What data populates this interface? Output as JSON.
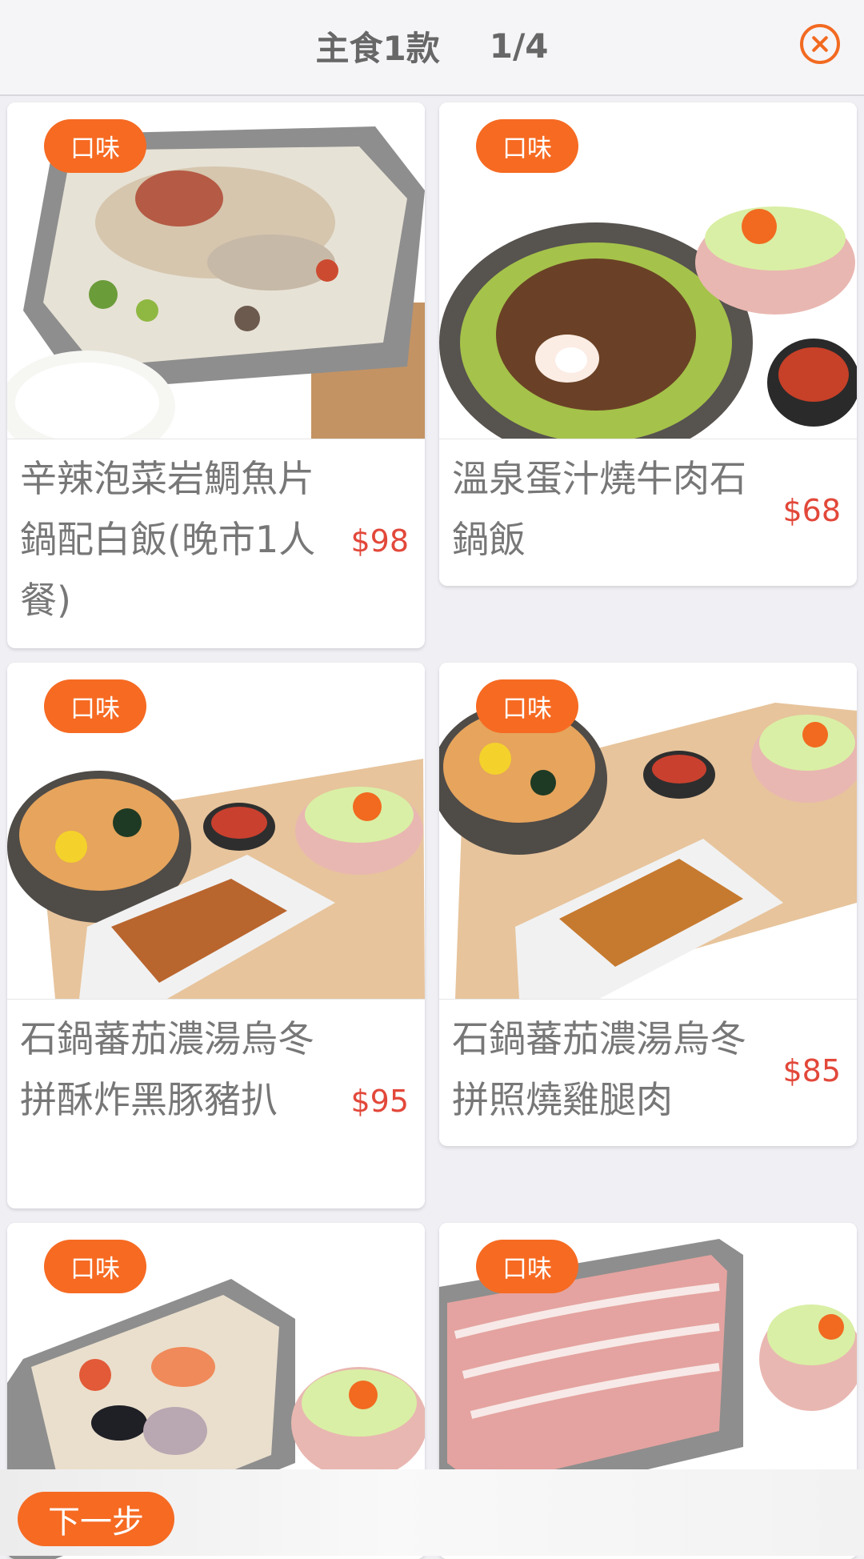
{
  "header": {
    "title": "主食1款",
    "page_indicator": "1/4"
  },
  "badge_label": "口味",
  "items": [
    {
      "name": "辛辣泡菜岩鯛魚片鍋配白飯(晚市1人餐)",
      "price": "$98"
    },
    {
      "name": "溫泉蛋汁燒牛肉石鍋飯",
      "price": "$68"
    },
    {
      "name": "石鍋蕃茄濃湯烏冬拼酥炸黑豚豬扒",
      "price": "$95"
    },
    {
      "name": "石鍋蕃茄濃湯烏冬拼照燒雞腿肉",
      "price": "$85"
    }
  ],
  "footer": {
    "next_label": "下一步"
  },
  "colors": {
    "accent": "#f66a22",
    "price": "#e2483a",
    "text": "#777777",
    "background": "#efeff4"
  },
  "icons": {
    "close": "close-icon"
  }
}
